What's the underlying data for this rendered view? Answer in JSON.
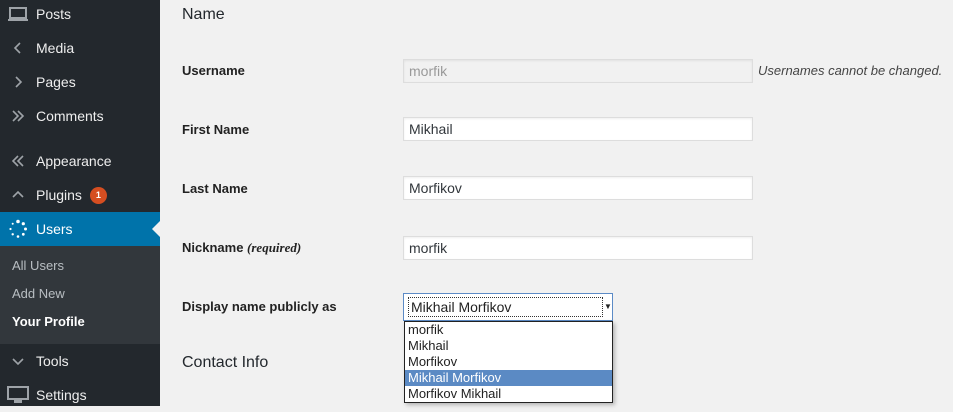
{
  "sidebar": {
    "items": [
      {
        "label": "Posts",
        "icon": "posts-icon"
      },
      {
        "label": "Media",
        "icon": "chevron-left-icon"
      },
      {
        "label": "Pages",
        "icon": "chevron-right-icon"
      },
      {
        "label": "Comments",
        "icon": "double-chevron-right-icon"
      },
      {
        "label": "Appearance",
        "icon": "double-chevron-left-icon"
      },
      {
        "label": "Plugins",
        "icon": "chevron-up-icon",
        "badge": "1"
      },
      {
        "label": "Users",
        "icon": "users-icon",
        "active": true
      },
      {
        "label": "Tools",
        "icon": "chevron-down-icon"
      },
      {
        "label": "Settings",
        "icon": "settings-icon"
      }
    ],
    "submenu": [
      "All Users",
      "Add New",
      "Your Profile"
    ],
    "colors": {
      "background": "#23282d",
      "active": "#0073aa",
      "submenu_bg": "#32373c",
      "badge": "#d54e21"
    }
  },
  "main": {
    "name_section": "Name",
    "contact_section": "Contact Info",
    "username": {
      "label": "Username",
      "value": "morfik",
      "hint": "Usernames cannot be changed."
    },
    "first_name": {
      "label": "First Name",
      "value": "Mikhail"
    },
    "last_name": {
      "label": "Last Name",
      "value": "Morfikov"
    },
    "nickname": {
      "label": "Nickname",
      "required": "(required)",
      "value": "morfik"
    },
    "display_name": {
      "label": "Display name publicly as",
      "value": "Mikhail Morfikov",
      "options": [
        "morfik",
        "Mikhail",
        "Morfikov",
        "Mikhail Morfikov",
        "Morfikov Mikhail"
      ],
      "selected_index": 3
    }
  }
}
